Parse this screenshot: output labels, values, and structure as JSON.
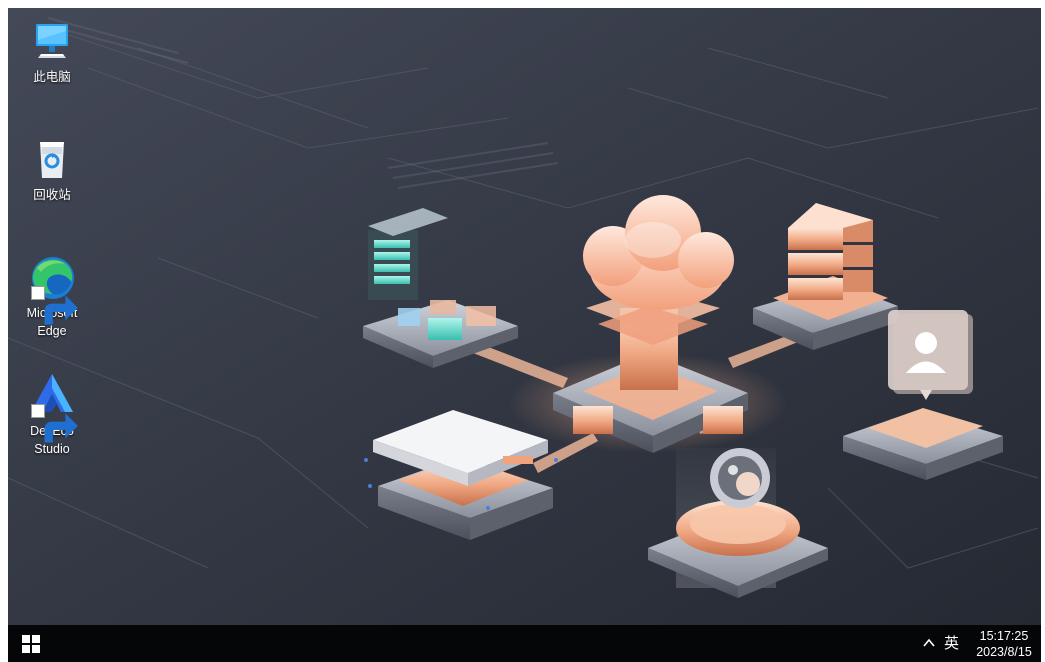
{
  "desktop": {
    "icons": [
      {
        "name": "this-pc",
        "label": "此电脑",
        "icon": "computer-monitor-icon"
      },
      {
        "name": "recycle-bin",
        "label": "回收站",
        "icon": "recycle-bin-icon"
      },
      {
        "name": "microsoft-edge",
        "label_line1": "Microsoft",
        "label_line2": "Edge",
        "icon": "edge-browser-icon",
        "shortcut": true
      },
      {
        "name": "deveco-studio",
        "label_line1": "DevEco",
        "label_line2": "Studio",
        "icon": "deveco-studio-icon",
        "shortcut": true
      }
    ]
  },
  "taskbar": {
    "start_icon": "windows-logo-icon",
    "tray_chevron": "^",
    "ime": "英",
    "time": "15:17:25",
    "date": "2023/8/15"
  },
  "colors": {
    "wallpaper_base": "#2f3440",
    "accent_copper": "#e8a07a",
    "accent_teal": "#5fe0d0",
    "taskbar": "#050607"
  }
}
